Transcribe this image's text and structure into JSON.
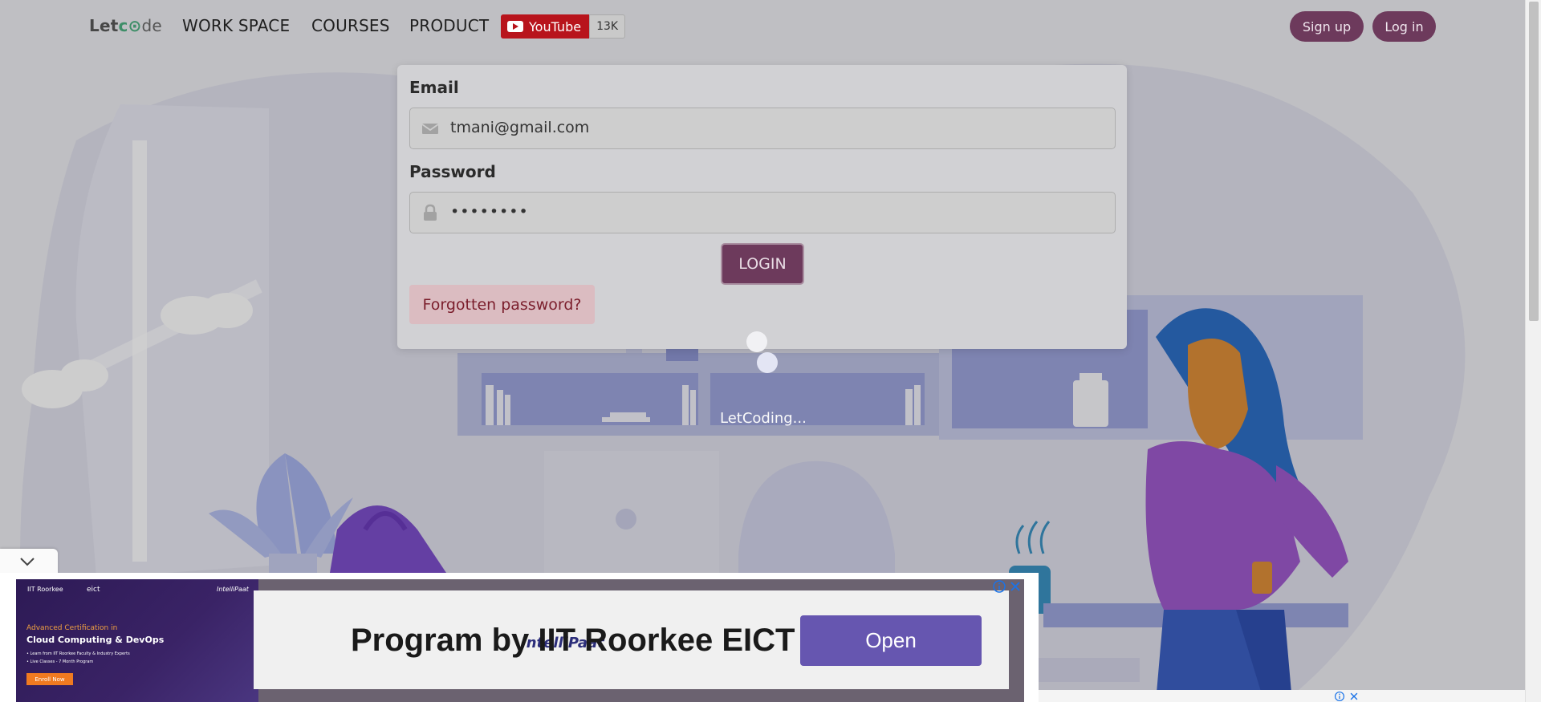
{
  "nav": {
    "logo_let": "Let",
    "logo_co": "c",
    "logo_o": "o",
    "logo_de": "de",
    "links": [
      "WORK SPACE",
      "COURSES",
      "PRODUCT"
    ],
    "youtube_label": "YouTube",
    "youtube_count": "13K",
    "signup": "Sign up",
    "login": "Log in"
  },
  "form": {
    "email_label": "Email",
    "email_value": "tmani@gmail.com",
    "password_label": "Password",
    "password_value": "••••••••",
    "login_button": "LOGIN",
    "forgot": "Forgotten password?"
  },
  "loader": {
    "text": "LetCoding..."
  },
  "ad": {
    "headline": "Program by IIT Roorkee EICT",
    "brand": "IntelliPaat",
    "open": "Open",
    "left_brand1": "IIT Roorkee",
    "left_brand2": "eict",
    "left_tag": "Advanced Certification in",
    "left_title": "Cloud Computing & DevOps",
    "left_b1": "• Learn from IIT Roorkee Faculty & Industry Experts",
    "left_b2": "• Live Classes - 7 Month Program",
    "left_enroll": "Enroll Now",
    "left_logo": "IntelliPaat"
  },
  "colors": {
    "accent": "#6d3a5c",
    "youtube": "#b8141c",
    "ad_button": "#6656b0"
  }
}
